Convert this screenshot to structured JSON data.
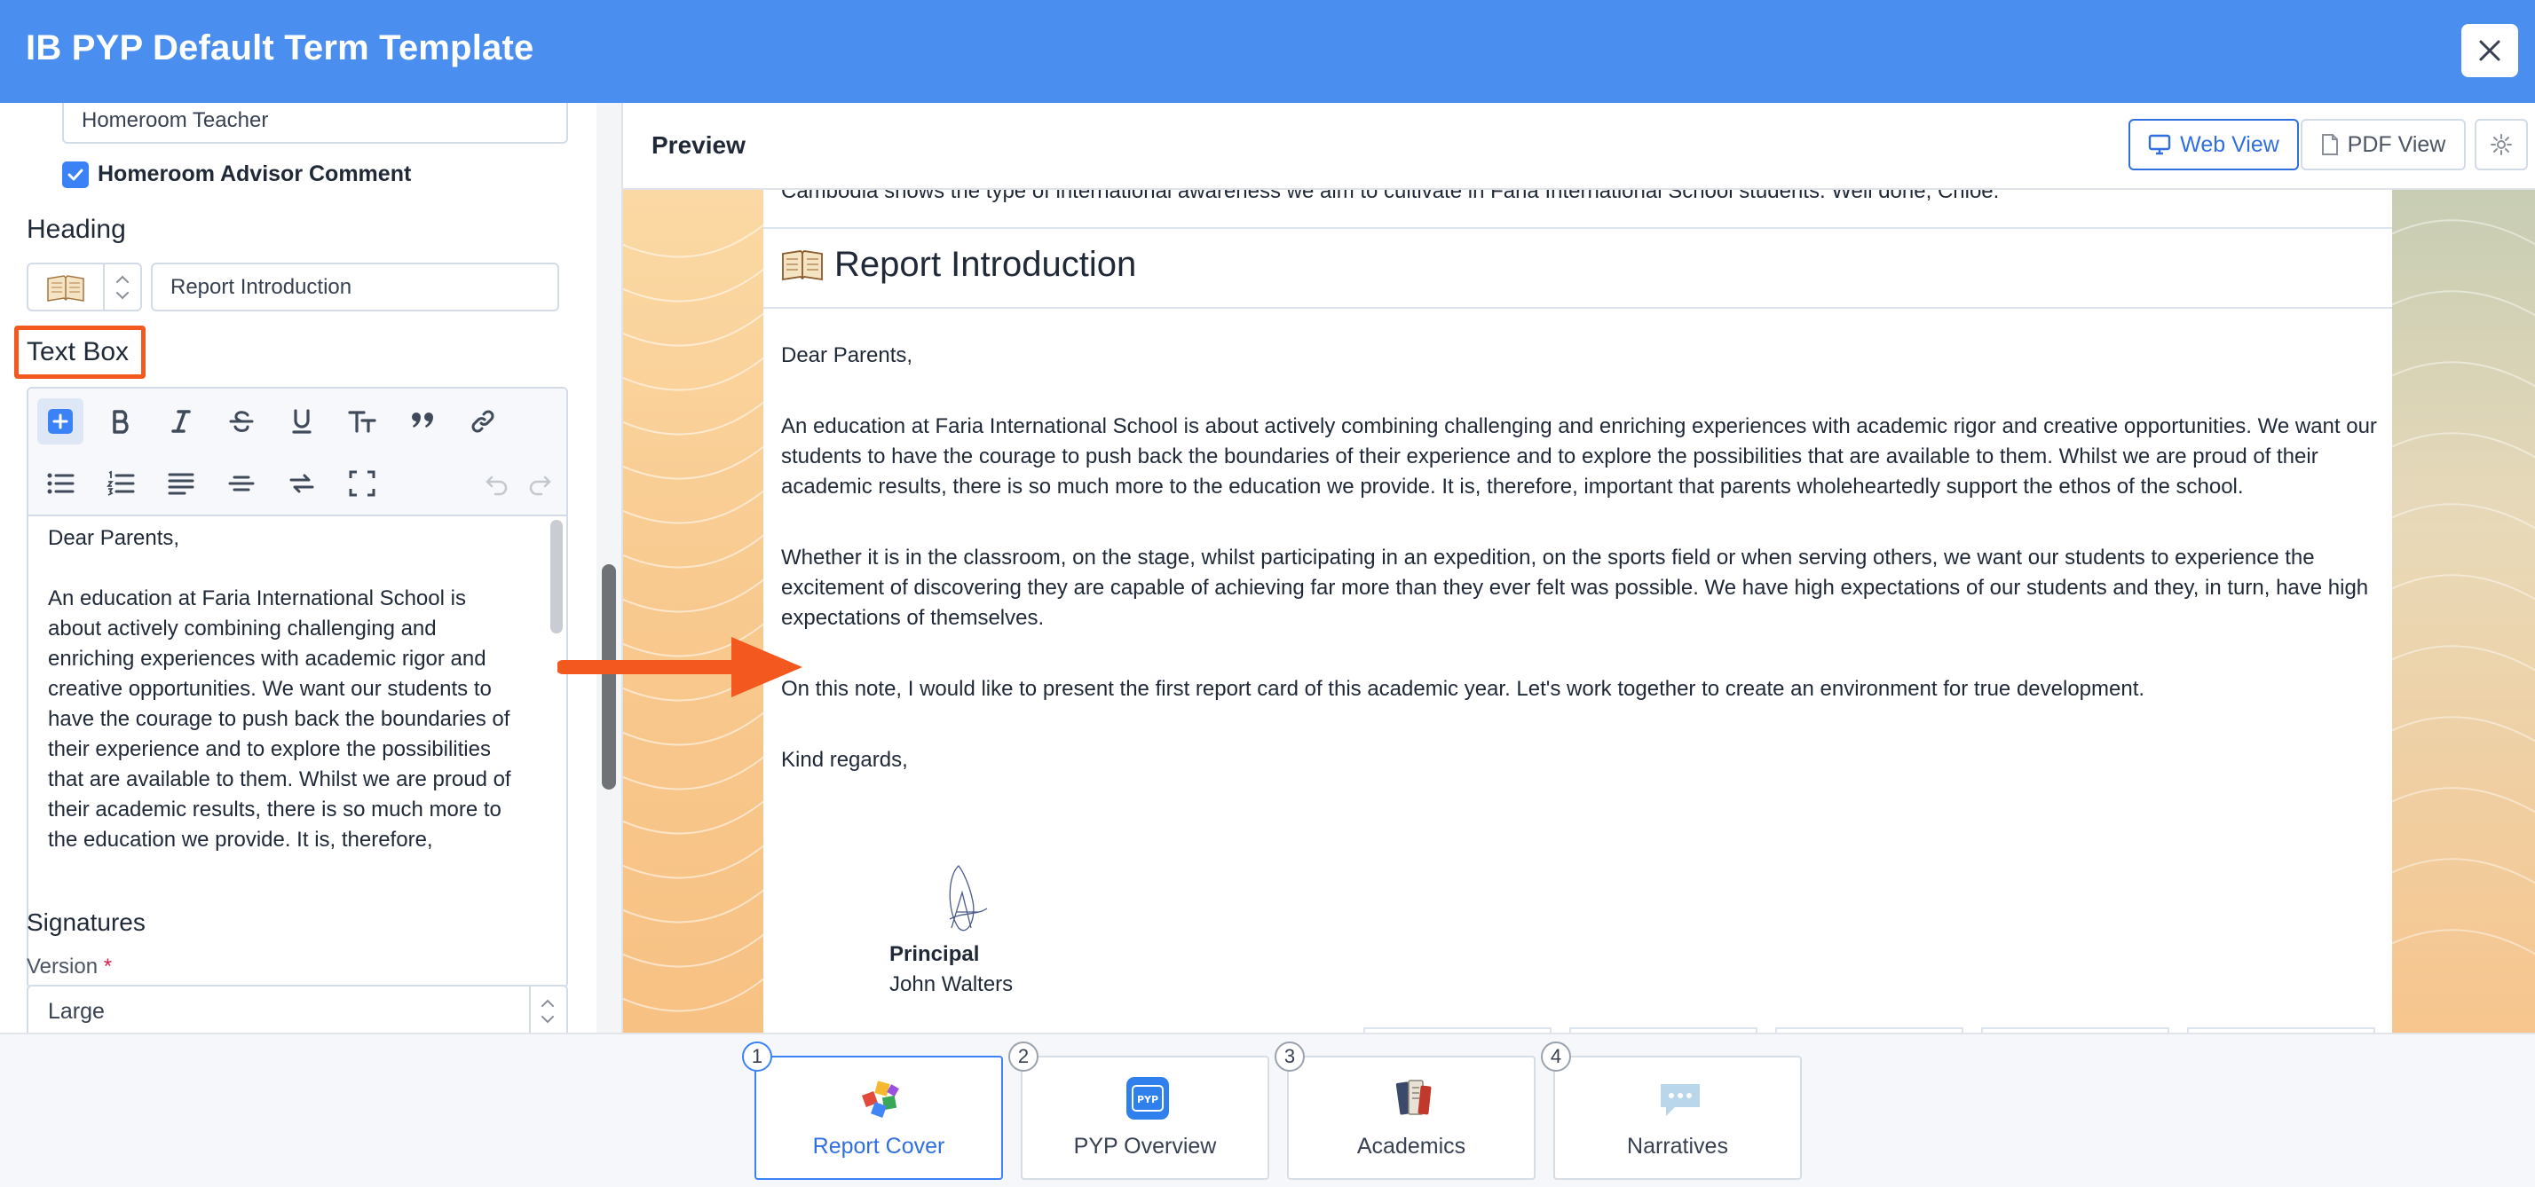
{
  "header": {
    "title": "IB PYP Default Term Template"
  },
  "left_panel": {
    "role_field_value": "Homeroom Teacher",
    "checkbox_label": "Homeroom Advisor Comment",
    "heading_label": "Heading",
    "heading_value": "Report Introduction",
    "textbox_label": "Text Box",
    "editor_paragraphs": [
      "Dear Parents,",
      "An education at Faria International School is about actively combining challenging and enriching experiences with academic rigor and creative opportunities. We want our students to have the courage to push back the boundaries of their experience and to explore the possibilities that are available to them. Whilst we are proud of their academic results, there is so much more to the education we provide. It is, therefore,"
    ],
    "signatures_label": "Signatures",
    "version_label": "Version",
    "required_mark": "*",
    "version_value": "Large"
  },
  "preview": {
    "title": "Preview",
    "web_view_label": "Web View",
    "pdf_view_label": "PDF View",
    "cut_line": "Cambodia shows the type of international awareness we aim to cultivate in Faria International School students. Well done, Chloe.",
    "section_heading": "Report Introduction",
    "paragraphs": [
      "Dear Parents,",
      "An education at Faria International School is about actively combining challenging and enriching experiences with academic rigor and creative opportunities. We want our students to have the courage to push back the boundaries of their experience and to explore the possibilities that are available to them. Whilst we are proud of their academic results, there is so much more to the education we provide. It is, therefore, important that parents wholeheartedly support the ethos of the school.",
      "Whether it is in the classroom, on the stage, whilst participating in an expedition, on the sports field or when serving others, we want our students to experience the excitement of discovering they are capable of achieving far more than they ever felt was possible. We have high expectations of our students and they, in turn, have high expectations of themselves.",
      "On this note, I would like to present the first report card of this academic year. Let's work together to create an environment for true development.",
      "Kind regards,"
    ],
    "signature_role": "Principal",
    "signature_name": "John Walters"
  },
  "steps": [
    {
      "num": "1",
      "label": "Report Cover",
      "icon": "puzzle-icon",
      "active": true
    },
    {
      "num": "2",
      "label": "PYP Overview",
      "icon": "pyp-icon",
      "active": false
    },
    {
      "num": "3",
      "label": "Academics",
      "icon": "books-icon",
      "active": false
    },
    {
      "num": "4",
      "label": "Narratives",
      "icon": "speech-bubble-icon",
      "active": false
    }
  ],
  "colors": {
    "header": "#4a8ef0",
    "accent": "#2f6fdf",
    "highlight": "#f3581e"
  },
  "pyp_icon_text": "PYP"
}
